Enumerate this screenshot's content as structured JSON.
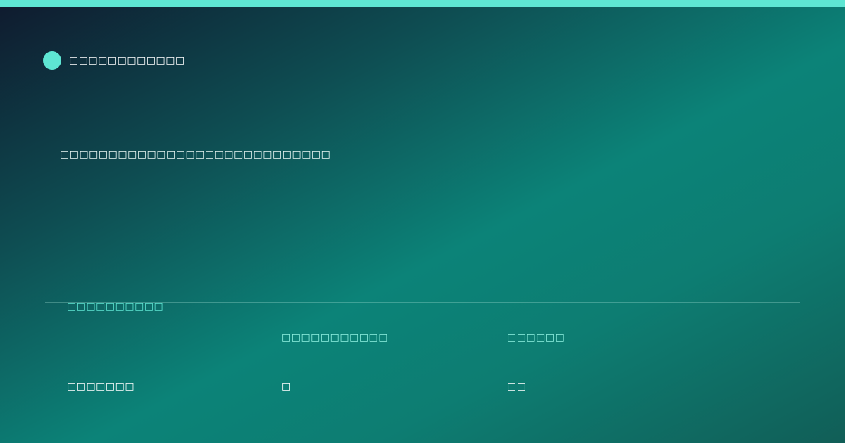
{
  "brand": {
    "name": "□□□□□□□□□□□□"
  },
  "headline": "□□□□□□□□□□□□□□□□□□□□□□□□□□□□",
  "table": {
    "section_label": "□□□□□□□□□□",
    "columns": [
      "",
      "□□□□□□□□□□□",
      "□□□□□□"
    ],
    "rows": [
      [
        "□□□□□□□",
        "□",
        "□□"
      ]
    ]
  },
  "colors": {
    "accent": "#5ee6d3",
    "background_dark": "#0f1a2e",
    "background_teal": "#0c8378"
  }
}
